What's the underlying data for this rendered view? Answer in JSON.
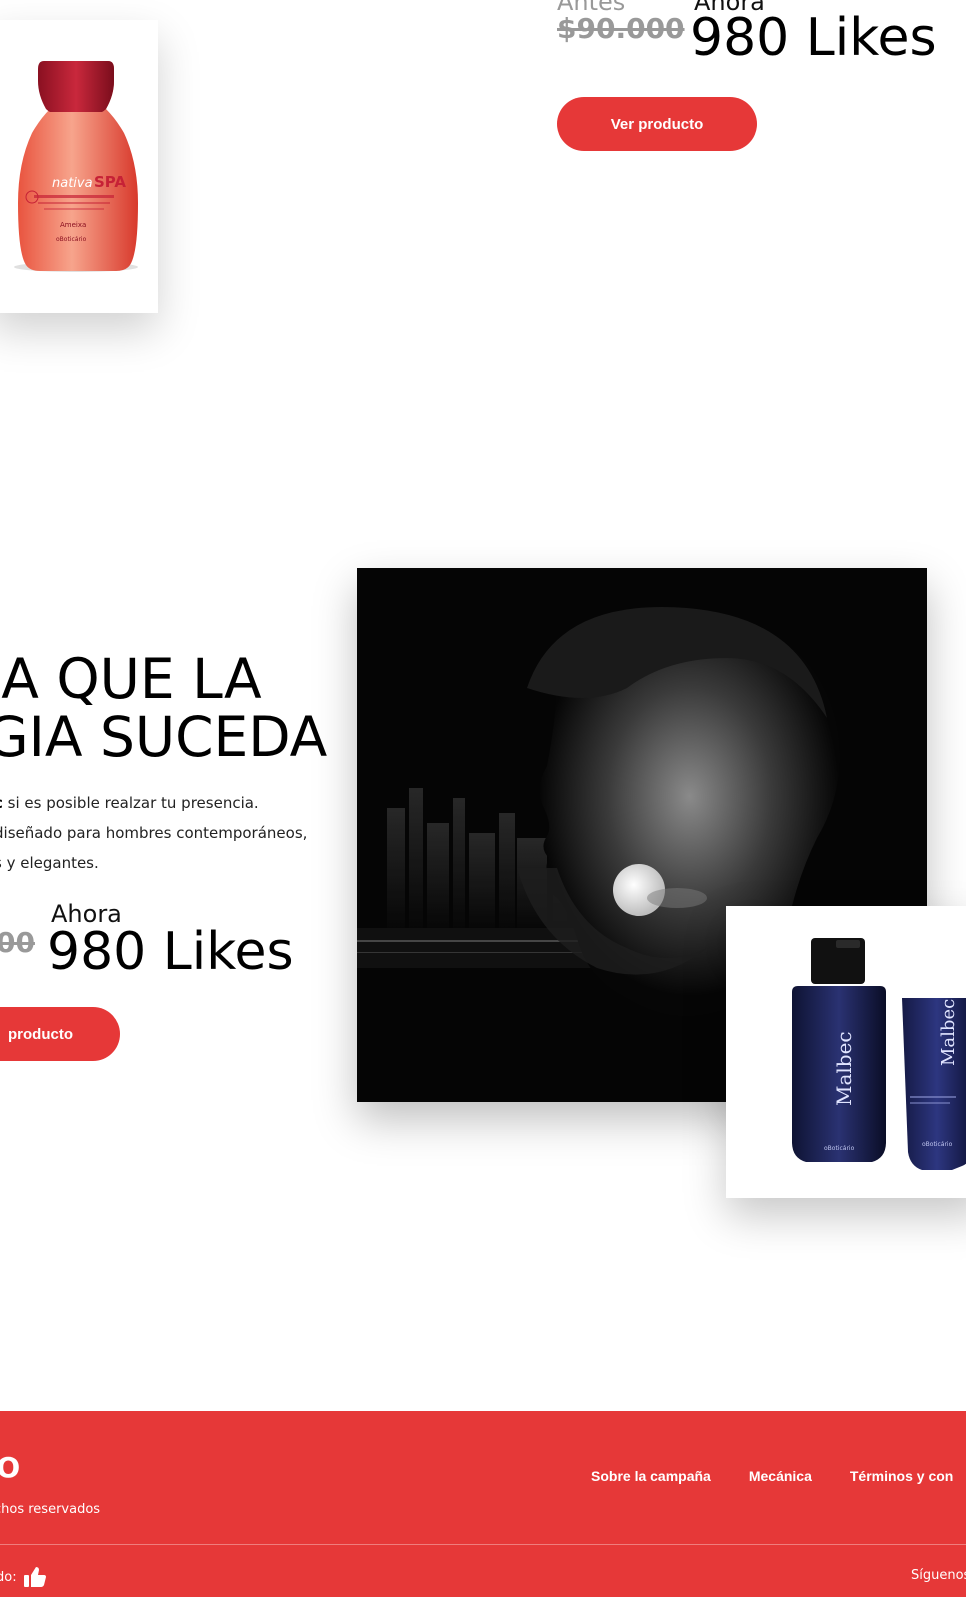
{
  "product_1": {
    "before_label": "Antes",
    "old_price": "$90.000",
    "now_label": "Ahora",
    "new_price": "980 Likes",
    "cta_label": "Ver producto",
    "image_alt": "Bottle of Nativa SPA moisturizing lotion"
  },
  "product_2": {
    "headline_line_1": "JA QUE LA",
    "headline_line_2": "GIA SUCEDA",
    "desc_bold": "c",
    "desc_line_1": " si es posible realzar tu presencia.",
    "desc_line_2": "diseñado para hombres contemporáneos,",
    "desc_line_3": "s y elegantes.",
    "old_price": "00",
    "now_label": "Ahora",
    "new_price": "980 Likes",
    "cta_label": "producto",
    "photo_alt": "Black and white portrait of a man with a city skyline and moon",
    "product_image_alt": "Malbec perfume bottle and tube"
  },
  "footer": {
    "brand": "IO",
    "rights": "chos reservados",
    "nav": [
      "Sobre la campaña",
      "Mecánica",
      "Términos y con"
    ],
    "liked_label": "do:",
    "follow_label": "Síguenos"
  },
  "colors": {
    "accent": "#e63838",
    "old_price": "#999999",
    "text": "#111111"
  },
  "icons": {
    "thumbs_up": "thumbs-up-icon"
  }
}
